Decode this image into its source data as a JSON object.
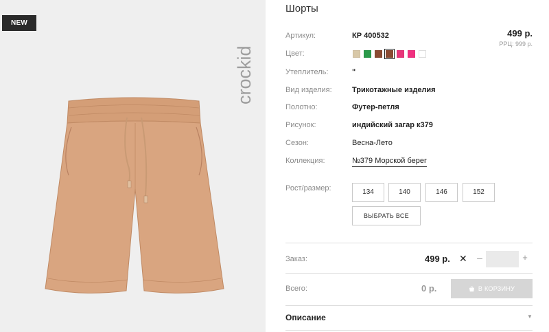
{
  "badge": {
    "new": "NEW"
  },
  "brand": {
    "logo_text": "crockid"
  },
  "product": {
    "title": "Шорты",
    "price": "499 р.",
    "rrp": "РРЦ: 999 р."
  },
  "attributes": [
    {
      "label": "Артикул:",
      "value": "КР 400532"
    },
    {
      "label": "Цвет:",
      "value": ""
    },
    {
      "label": "Утеплитель:",
      "value": "\""
    },
    {
      "label": "Вид изделия:",
      "value": "Трикотажные изделия"
    },
    {
      "label": "Полотно:",
      "value": "Футер-петля"
    },
    {
      "label": "Рисунок:",
      "value": "индийский загар к379"
    },
    {
      "label": "Сезон:",
      "value": "Весна-Лето"
    },
    {
      "label": "Коллекция:",
      "value": "№379 Морской берег"
    }
  ],
  "colors": [
    "#d8c8a8",
    "#2a9a4a",
    "#8a4a32",
    "#8a4a32",
    "#e8357a",
    "#f0307f",
    "#ffffff"
  ],
  "selected_color_index": 3,
  "sizes": {
    "label": "Рост/размер:",
    "options": [
      "134",
      "140",
      "146",
      "152"
    ],
    "select_all": "ВЫБРАТЬ ВСЕ"
  },
  "order": {
    "label": "Заказ:",
    "price": "499 р.",
    "times": "✕",
    "minus": "–",
    "plus": "+",
    "quantity": ""
  },
  "total": {
    "label": "Всего:",
    "value": "0 р.",
    "cart_button": "В КОРЗИНУ"
  },
  "description": {
    "title": "Описание"
  },
  "icons": {
    "cart": "cart-icon",
    "chevron": "chevron-down-icon"
  }
}
